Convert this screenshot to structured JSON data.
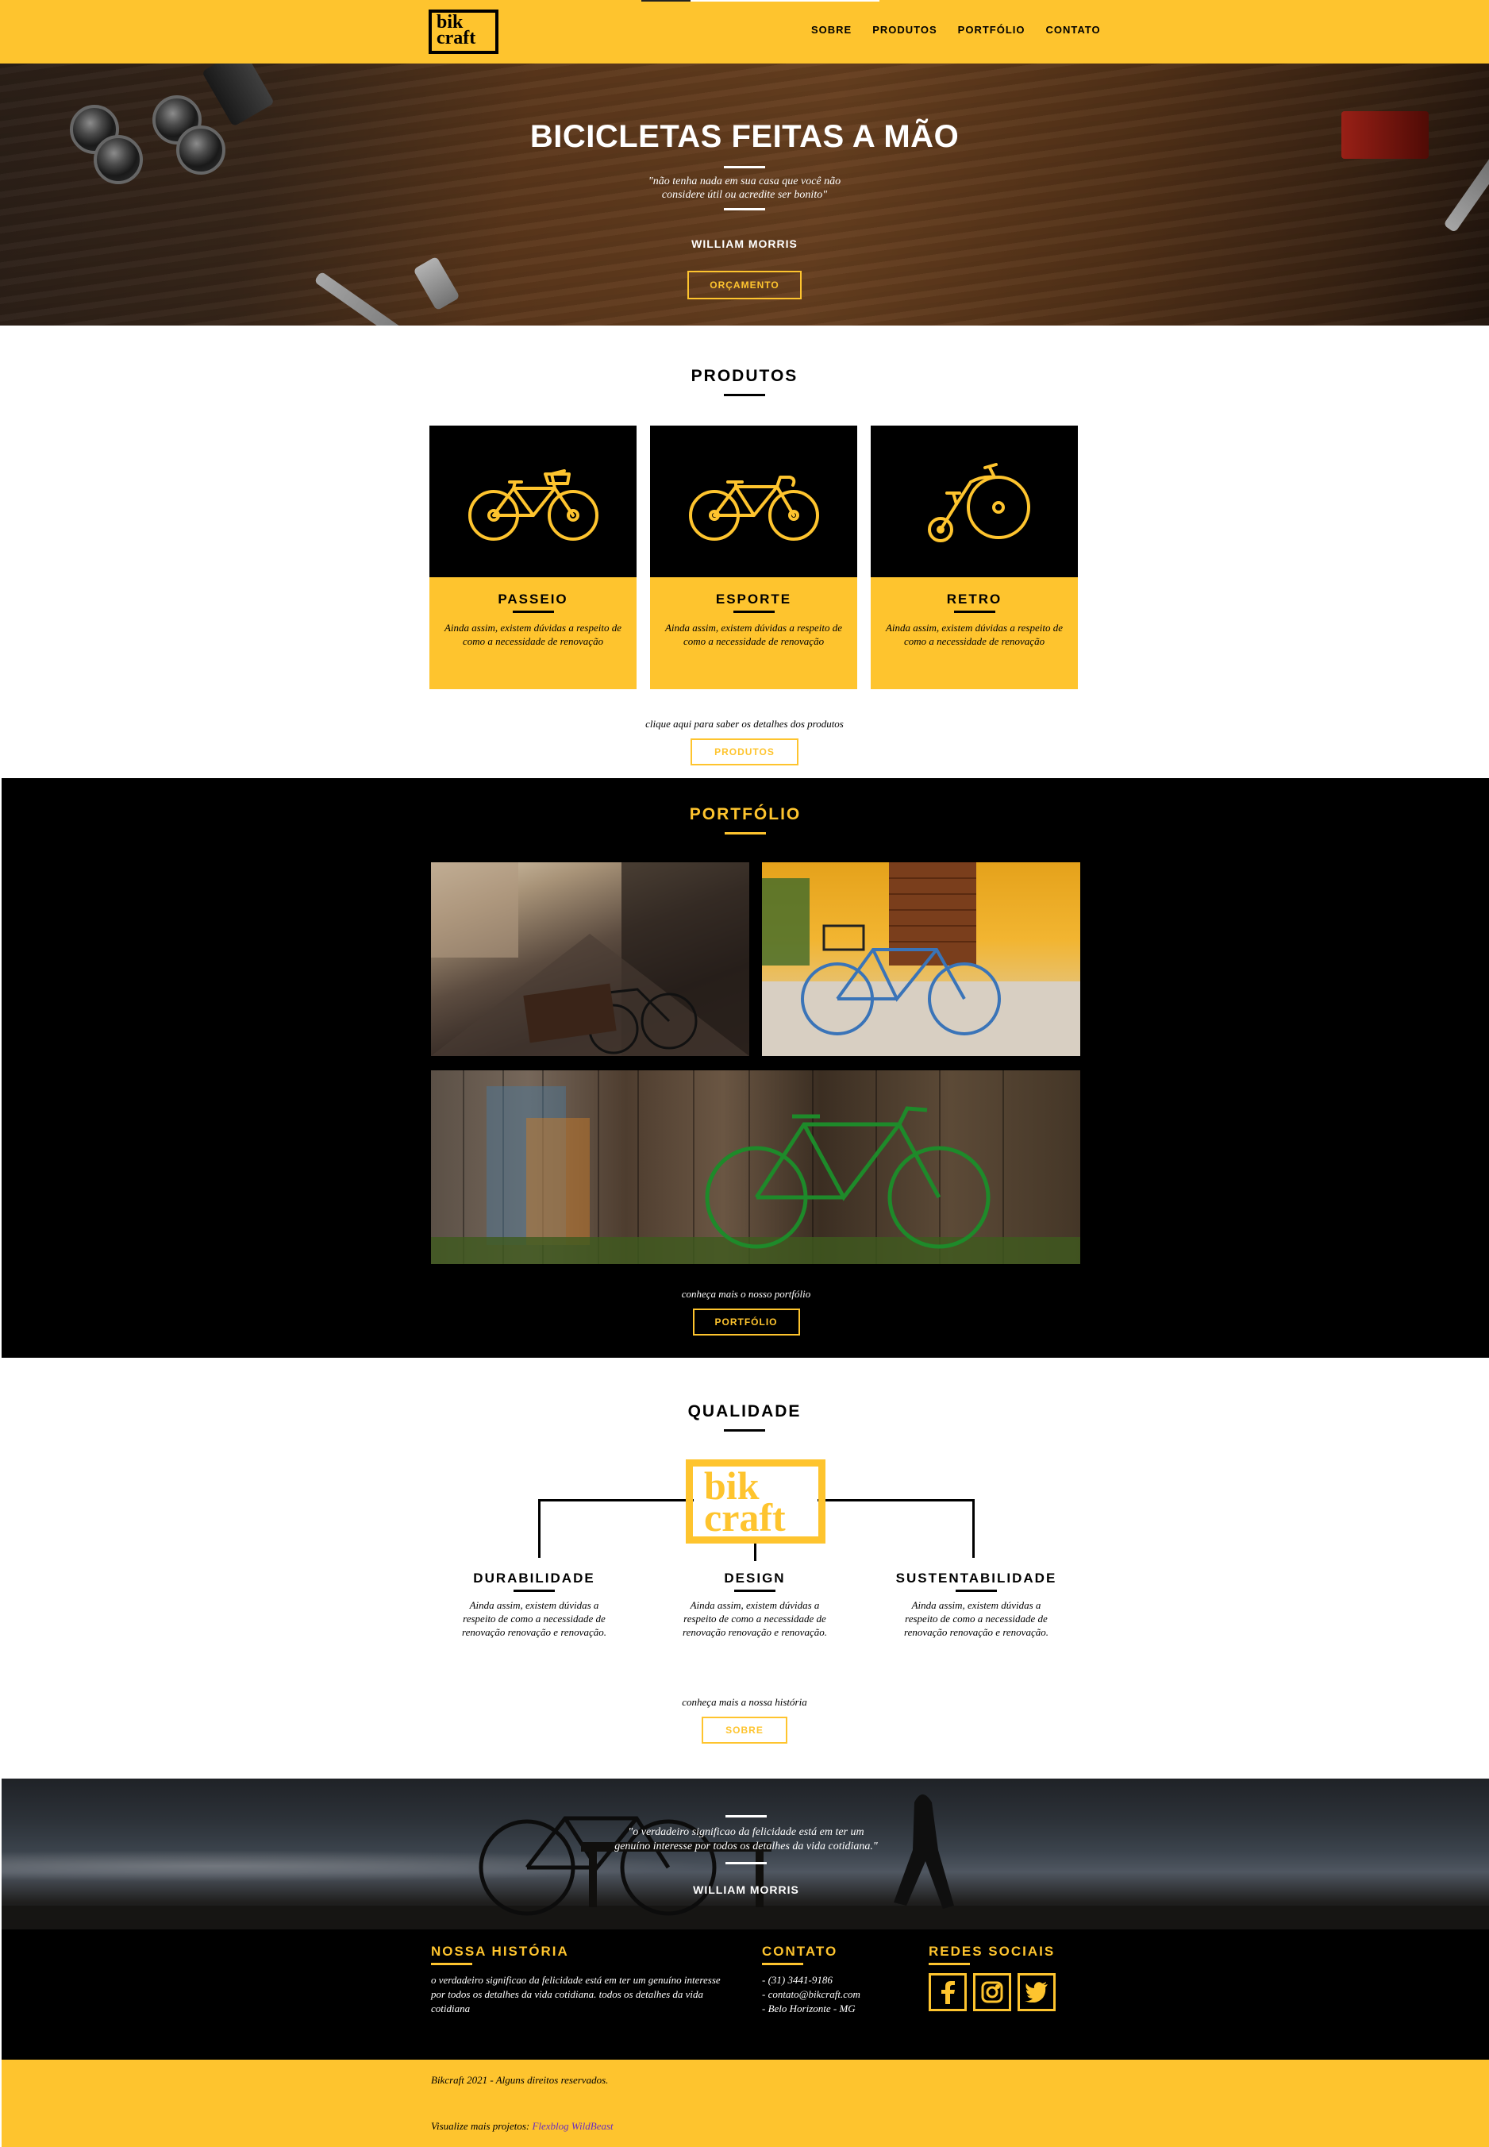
{
  "header": {
    "logo_line1": "bik",
    "logo_line2": "craft",
    "nav": [
      "SOBRE",
      "PRODUTOS",
      "PORTFÓLIO",
      "CONTATO"
    ]
  },
  "hero": {
    "title": "BICICLETAS FEITAS A MÃO",
    "quote": "\"não tenha nada em sua casa que você não considere útil ou acredite ser bonito\"",
    "author": "WILLIAM MORRIS",
    "button": "ORÇAMENTO"
  },
  "produtos": {
    "title": "PRODUTOS",
    "cards": [
      {
        "title": "PASSEIO",
        "text": "Ainda assim, existem dúvidas a respeito de como a necessidade de renovação",
        "icon": "city-bike-icon"
      },
      {
        "title": "ESPORTE",
        "text": "Ainda assim, existem dúvidas a respeito de como a necessidade de renovação",
        "icon": "road-bike-icon"
      },
      {
        "title": "RETRO",
        "text": "Ainda assim, existem dúvidas a respeito de como a necessidade de renovação",
        "icon": "penny-farthing-icon"
      }
    ],
    "cta_text": "clique aqui para saber os detalhes dos produtos",
    "button": "PRODUTOS"
  },
  "portfolio": {
    "title": "PORTFÓLIO",
    "cta_text": "conheça mais o nosso portfólio",
    "button": "PORTFÓLIO"
  },
  "qualidade": {
    "title": "QUALIDADE",
    "logo_line1": "bik",
    "logo_line2": "craft",
    "features": [
      {
        "title": "DURABILIDADE",
        "text": "Ainda assim, existem dúvidas a respeito de como a necessidade de renovação renovação e renovação."
      },
      {
        "title": "DESIGN",
        "text": "Ainda assim, existem dúvidas a respeito de como a necessidade de renovação renovação e renovação."
      },
      {
        "title": "SUSTENTABILIDADE",
        "text": "Ainda assim, existem dúvidas a respeito de como a necessidade de renovação renovação e renovação."
      }
    ],
    "cta_text": "conheça mais a nossa história",
    "button": "SOBRE"
  },
  "banner": {
    "quote": "\"o verdadeiro significao da felicidade está em ter um genuíno interesse por todos os detalhes da vida cotidiana.\"",
    "author": "WILLIAM MORRIS"
  },
  "footer": {
    "historia_title": "NOSSA HISTÓRIA",
    "historia_text": "o verdadeiro significao da felicidade está em ter um genuíno interesse por todos os detalhes da vida cotidiana. todos os detalhes da vida cotidiana",
    "contato_title": "CONTATO",
    "contato_items": [
      "- (31) 3441-9186",
      "- contato@bikcraft.com",
      "- Belo Horizonte - MG"
    ],
    "redes_title": "REDES SOCIAIS",
    "social_icons": [
      "facebook-icon",
      "instagram-icon",
      "twitter-icon"
    ]
  },
  "copyright": {
    "text": "Bikcraft 2021 - Alguns direitos reservados.",
    "projects_prefix": "Visualize mais projetos: ",
    "projects_link": "Flexblog WildBeast"
  },
  "colors": {
    "accent": "#FEC42E",
    "dark": "#000000",
    "link": "#6a2dbf"
  }
}
